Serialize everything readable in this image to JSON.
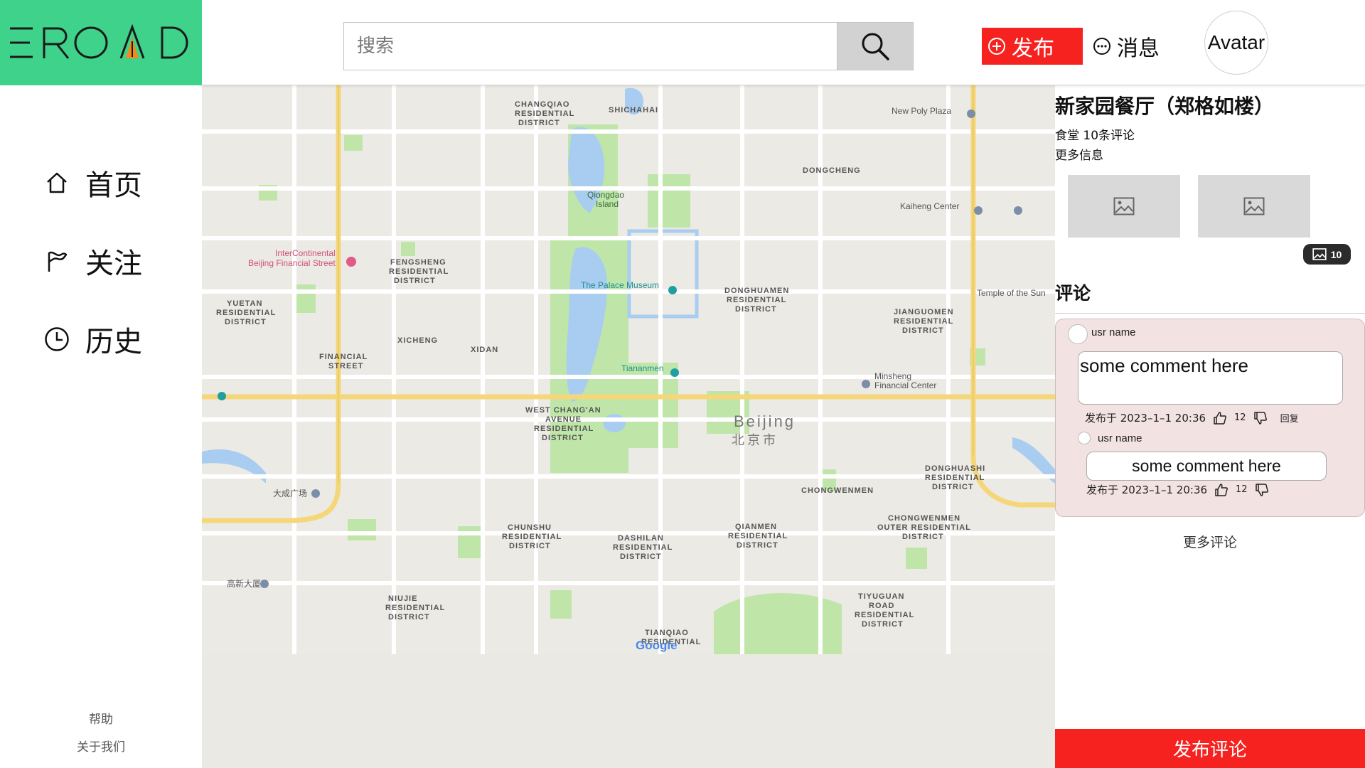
{
  "header": {
    "logo": "EROAD",
    "search_placeholder": "搜索",
    "publish_label": "发布",
    "messages_label": "消息",
    "avatar_label": "Avatar"
  },
  "sidebar": {
    "items": [
      {
        "label": "首页",
        "icon": "home-icon"
      },
      {
        "label": "关注",
        "icon": "flag-icon"
      },
      {
        "label": "历史",
        "icon": "clock-icon"
      }
    ],
    "footer": {
      "help": "帮助",
      "about": "关于我们"
    }
  },
  "map": {
    "districts": [
      "CHANGQIAO RESIDENTIAL DISTRICT",
      "SHICHAHAI 什刹海",
      "DONGCHENG 东城区",
      "Qiongdao Island 琼岛",
      "The Palace Museum 故宫博物院",
      "FENGSHENG RESIDENTIAL DISTRICT 丰盛",
      "YUETAN RESIDENTIAL DISTRICT 月坛",
      "XICHENG 西城区",
      "XIDAN 西单",
      "FINANCIAL STREET 金融街",
      "Tiananmen 天安门",
      "DONGHUAMEN RESIDENTIAL DISTRICT 东华门",
      "JIANGUOMEN RESIDENTIAL DISTRICT 建国门",
      "WEST CHANG'AN AVENUE RESIDENTIAL DISTRICT 西长安街",
      "Beijing 北京市",
      "CHONGWENMEN 崇文门",
      "DONGHUASHI RESIDENTIAL DISTRICT 东花市",
      "CHUNSHU RESIDENTIAL DISTRICT 椿树",
      "DASHILAN RESIDENTIAL DISTRICT 大栅栏",
      "QIANMEN RESIDENTIAL DISTRICT 前门",
      "CHONGWENMEN OUTER RESIDENTIAL DISTRICT 崇文门外",
      "NIUJIE RESIDENTIAL DISTRICT 牛街",
      "TIYUGUAN ROAD RESIDENTIAL DISTRICT 体育馆路",
      "TIANQIAO RESIDENTIAL DISTRICT"
    ],
    "pois": [
      "InterContinental Beijing Financial Street 北京金融街洲际酒店",
      "New Poly Plaza 新保利大厦",
      "Kaiheng Center 凯恒中心",
      "Minsheng Financial Center 民生金融中心",
      "Temple of the Sun 日坛",
      "大成广场",
      "高新大厦"
    ],
    "attribution": "Google"
  },
  "place": {
    "title": "新家园餐厅（郑格如楼）",
    "meta": "食堂 10条评论",
    "more_info": "更多信息",
    "photo_count": "10"
  },
  "comments": {
    "heading": "评论",
    "items": [
      {
        "user": "usr name",
        "text": "some comment here",
        "meta": "发布于 2023–1–1 20:36",
        "likes": "12",
        "reply": "回复"
      },
      {
        "user": "usr name",
        "text": "some comment here",
        "meta": "发布于 2023–1–1 20:36",
        "likes": "12"
      }
    ],
    "more": "更多评论",
    "post_button": "发布评论"
  },
  "colors": {
    "brand": "#3ed28a",
    "accent": "#f52220",
    "comment_bg": "#f3e2e2"
  }
}
